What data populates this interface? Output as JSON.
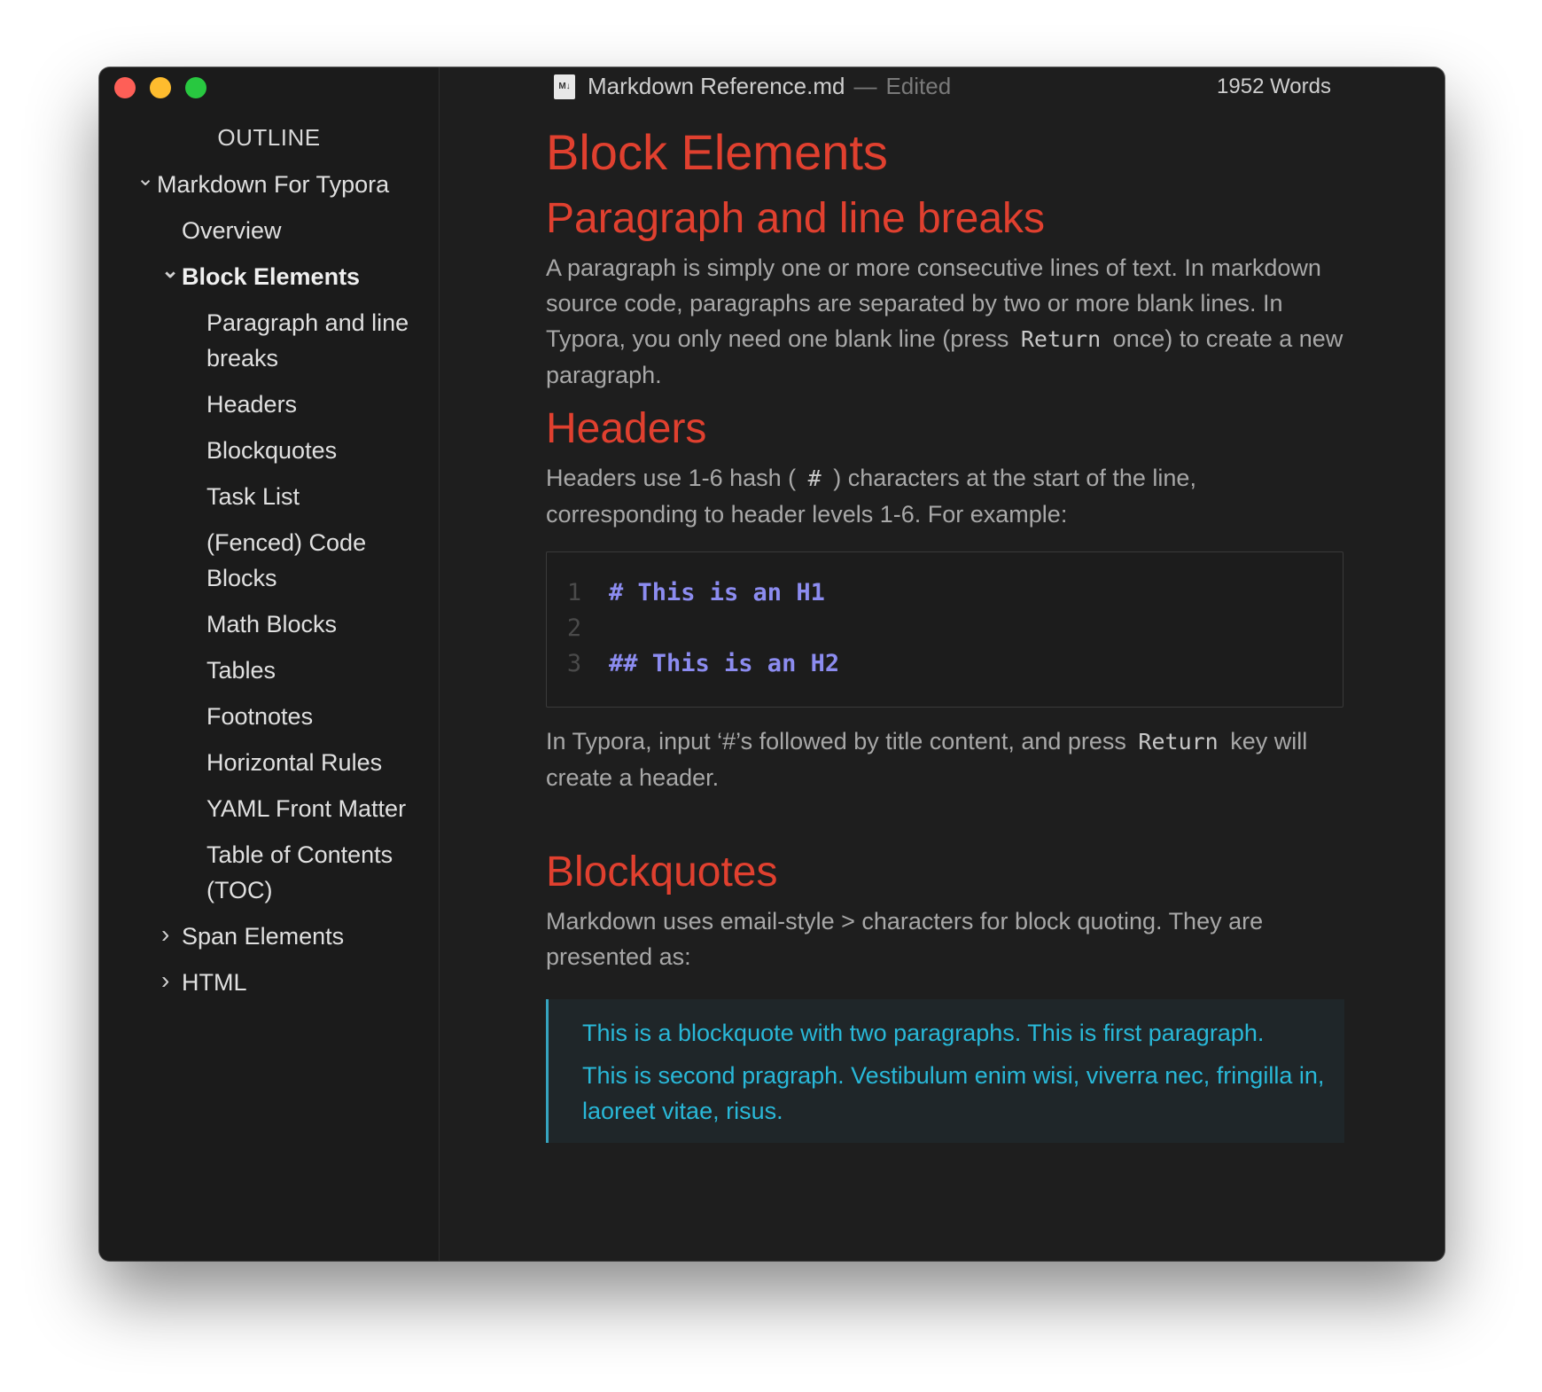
{
  "window": {
    "title": "Markdown Reference.md",
    "title_sep": "—",
    "status": "Edited",
    "doc_icon_text": "M↓",
    "word_count": "1952 Words"
  },
  "sidebar": {
    "title": "OUTLINE",
    "items": [
      {
        "label": "Markdown For Typora",
        "level": 1,
        "chevron": "expanded"
      },
      {
        "label": "Overview",
        "level": 2,
        "chevron": "none"
      },
      {
        "label": "Block Elements",
        "level": 2,
        "chevron": "expanded",
        "active": true
      },
      {
        "label": "Paragraph and line breaks",
        "level": 3,
        "chevron": "none"
      },
      {
        "label": "Headers",
        "level": 3,
        "chevron": "none"
      },
      {
        "label": "Blockquotes",
        "level": 3,
        "chevron": "none"
      },
      {
        "label": "Task List",
        "level": 3,
        "chevron": "none"
      },
      {
        "label": "(Fenced) Code Blocks",
        "level": 3,
        "chevron": "none"
      },
      {
        "label": "Math Blocks",
        "level": 3,
        "chevron": "none"
      },
      {
        "label": "Tables",
        "level": 3,
        "chevron": "none"
      },
      {
        "label": "Footnotes",
        "level": 3,
        "chevron": "none"
      },
      {
        "label": "Horizontal Rules",
        "level": 3,
        "chevron": "none"
      },
      {
        "label": "YAML Front Matter",
        "level": 3,
        "chevron": "none"
      },
      {
        "label": "Table of Contents (TOC)",
        "level": 3,
        "chevron": "none"
      },
      {
        "label": "Span Elements",
        "level": 2,
        "chevron": "collapsed"
      },
      {
        "label": "HTML",
        "level": 2,
        "chevron": "collapsed"
      }
    ]
  },
  "doc": {
    "h1": "Block Elements",
    "section_paragraph": {
      "heading": "Paragraph and line breaks",
      "text_before": "A paragraph is simply one or more consecutive lines of text. In markdown source code, paragraphs are separated by two or more blank lines. In Typora, you only need one blank line (press",
      "code": "Return",
      "text_after": "once) to create a new paragraph."
    },
    "section_headers": {
      "heading": "Headers",
      "text_before": "Headers use 1-6 hash (",
      "code": "#",
      "text_after": ") characters at the start of the line, corresponding to header levels 1-6. For example:",
      "code_lines": [
        {
          "num": "1",
          "text": "# This is an H1"
        },
        {
          "num": "2",
          "text": ""
        },
        {
          "num": "3",
          "text": "## This is an H2"
        }
      ],
      "after_before": "In Typora, input ‘#’s followed by title content, and press",
      "after_code": "Return",
      "after_after": "key will create a header."
    },
    "section_blockquotes": {
      "heading": "Blockquotes",
      "text": "Markdown uses email-style > characters for block quoting. They are presented as:",
      "quote_p1": "This is a blockquote with two paragraphs. This is first paragraph.",
      "quote_p2": "This is second pragraph. Vestibulum enim wisi, viverra nec, fringilla in, laoreet vitae, risus."
    }
  },
  "colors": {
    "heading": "#e0402f",
    "code_text": "#8c8cf0",
    "quote_text": "#29b8d8",
    "quote_border": "#36a4bf",
    "background": "#1e1e1e"
  }
}
